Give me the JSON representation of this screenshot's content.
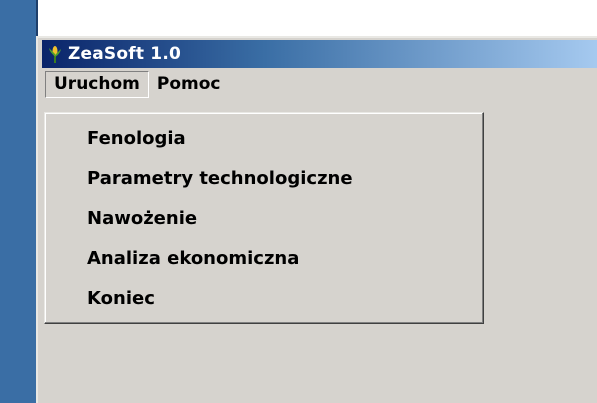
{
  "window": {
    "title": "ZeaSoft 1.0",
    "icon": "corn-plant-icon"
  },
  "menubar": {
    "items": [
      "Uruchom",
      "Pomoc"
    ],
    "active": "Uruchom"
  },
  "dropdown": {
    "items": [
      "Fenologia",
      "Parametry technologiczne",
      "Nawożenie",
      "Analiza ekonomiczna",
      "Koniec"
    ]
  },
  "colors": {
    "title_bar_start": "#0a246a",
    "title_bar_end": "#a6caf0",
    "window_face": "#d6d3ce",
    "desktop": "#3a6ea5"
  }
}
